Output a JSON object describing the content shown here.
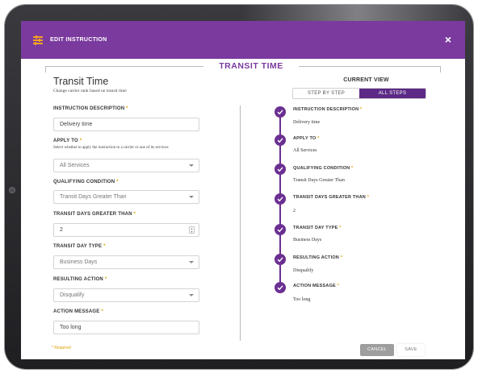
{
  "header": {
    "title": "EDIT INSTRUCTION",
    "close_icon": "×",
    "color": "#7a3a9e"
  },
  "section": {
    "title": "TRANSIT TIME"
  },
  "form": {
    "title": "Transit Time",
    "subtitle": "Change carrier rank based on transit time",
    "required_marker": "*",
    "fields": {
      "description": {
        "label": "INSTRUCTION DESCRIPTION",
        "value": "Delivery time"
      },
      "apply_to": {
        "label": "APPLY TO",
        "help": "Select whether to apply the instruction to a carrier or one of its services",
        "value": "All Services"
      },
      "qualifying": {
        "label": "QUALIFYING CONDITION",
        "value": "Transit Days Greater Than"
      },
      "transit_days": {
        "label": "TRANSIT DAYS GREATER THAN",
        "value": "2"
      },
      "day_type": {
        "label": "TRANSIT DAY TYPE",
        "value": "Business Days"
      },
      "resulting_action": {
        "label": "RESULTING ACTION",
        "value": "Disqualify"
      },
      "action_message": {
        "label": "ACTION MESSAGE",
        "value": "Too long"
      }
    },
    "required_note": "* Required"
  },
  "current_view": {
    "title": "CURRENT VIEW",
    "options": [
      "STEP BY STEP",
      "ALL STEPS"
    ],
    "selected": "ALL STEPS",
    "steps": [
      {
        "label": "INSTRUCTION DESCRIPTION",
        "value": "Delivery time"
      },
      {
        "label": "APPLY TO",
        "value": "All Services"
      },
      {
        "label": "QUALIFYING CONDITION",
        "value": "Transit Days Greater Than"
      },
      {
        "label": "TRANSIT DAYS GREATER THAN",
        "value": "2"
      },
      {
        "label": "TRANSIT DAY TYPE",
        "value": "Business Days"
      },
      {
        "label": "RESULTING ACTION",
        "value": "Disqualify"
      },
      {
        "label": "ACTION MESSAGE",
        "value": "Too long"
      }
    ]
  },
  "footer": {
    "cancel_label": "CANCEL",
    "save_label": "SAVE"
  }
}
